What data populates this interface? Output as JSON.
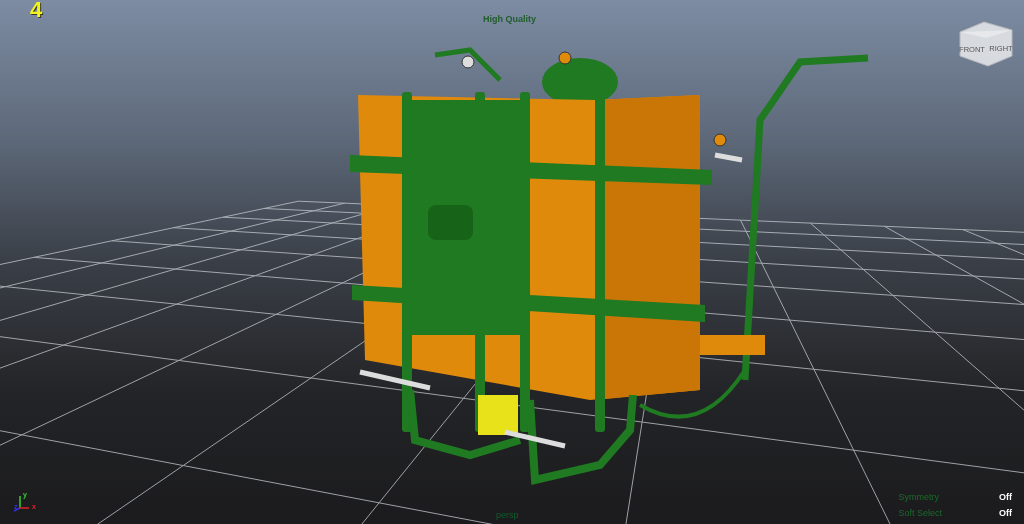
{
  "viewport": {
    "frame_number": "4",
    "quality_label": "High Quality",
    "camera_name": "persp",
    "view_cube": {
      "faces": [
        "FRONT",
        "RIGHT"
      ]
    },
    "axis_labels": [
      "y",
      "z",
      "x"
    ],
    "hud": [
      {
        "label": "Symmetry",
        "value": "Off"
      },
      {
        "label": "Soft Select",
        "value": "Off"
      }
    ]
  }
}
